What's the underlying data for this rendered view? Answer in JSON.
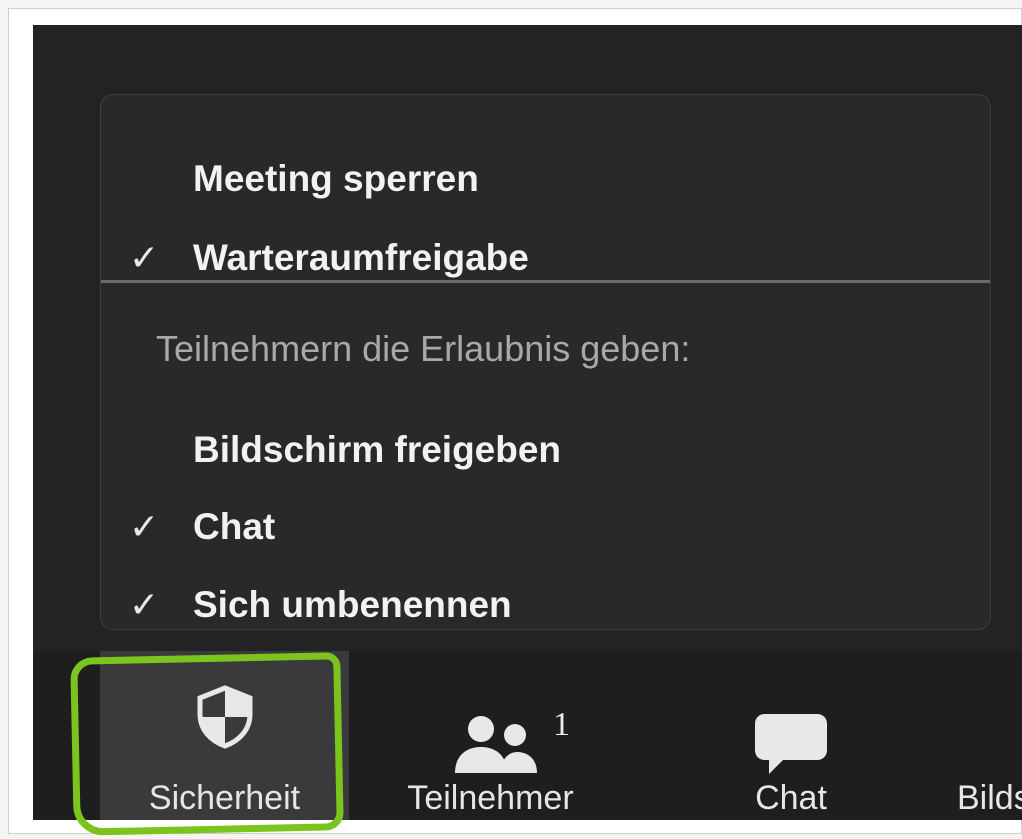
{
  "security_menu": {
    "items": [
      {
        "label": "Meeting sperren",
        "checked": false
      },
      {
        "label": "Warteraumfreigabe",
        "checked": true
      }
    ],
    "section_label": "Teilnehmern die Erlaubnis geben:",
    "permissions": [
      {
        "label": "Bildschirm freigeben",
        "checked": false
      },
      {
        "label": "Chat",
        "checked": true
      },
      {
        "label": "Sich umbenennen",
        "checked": true
      }
    ],
    "check_glyph": "✓"
  },
  "toolbar": {
    "buttons": [
      {
        "label": "Sicherheit",
        "icon": "shield-icon",
        "active": true
      },
      {
        "label": "Teilnehmer",
        "icon": "participants-icon",
        "badge": "1"
      },
      {
        "label": "Chat",
        "icon": "chat-bubble-icon"
      },
      {
        "label": "Bildschirm freigeben",
        "icon": "share-screen-icon"
      }
    ]
  },
  "colors": {
    "app_bg": "#232324",
    "menu_bg": "#29292b",
    "highlight": "#7bc41e"
  }
}
